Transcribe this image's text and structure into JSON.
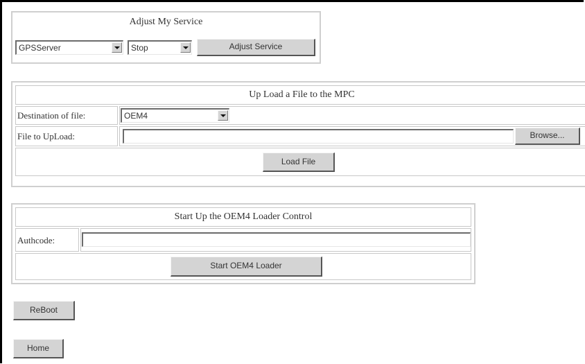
{
  "adjust_service": {
    "title": "Adjust My Service",
    "service_select": {
      "value": "GPSServer",
      "icon": "chevron-down-icon"
    },
    "action_select": {
      "value": "Stop",
      "icon": "chevron-down-icon"
    },
    "submit_label": "Adjust Service"
  },
  "upload": {
    "title": "Up Load a File to the MPC",
    "destination_label": "Destination of file:",
    "destination_value": "OEM4",
    "file_label": "File to UpLoad:",
    "file_value": "",
    "browse_label": "Browse...",
    "load_label": "Load File"
  },
  "loader": {
    "title": "Start Up the OEM4 Loader Control",
    "authcode_label": "Authcode:",
    "authcode_value": "",
    "start_label": "Start OEM4 Loader"
  },
  "actions": {
    "reboot_label": "ReBoot",
    "home_label": "Home"
  }
}
